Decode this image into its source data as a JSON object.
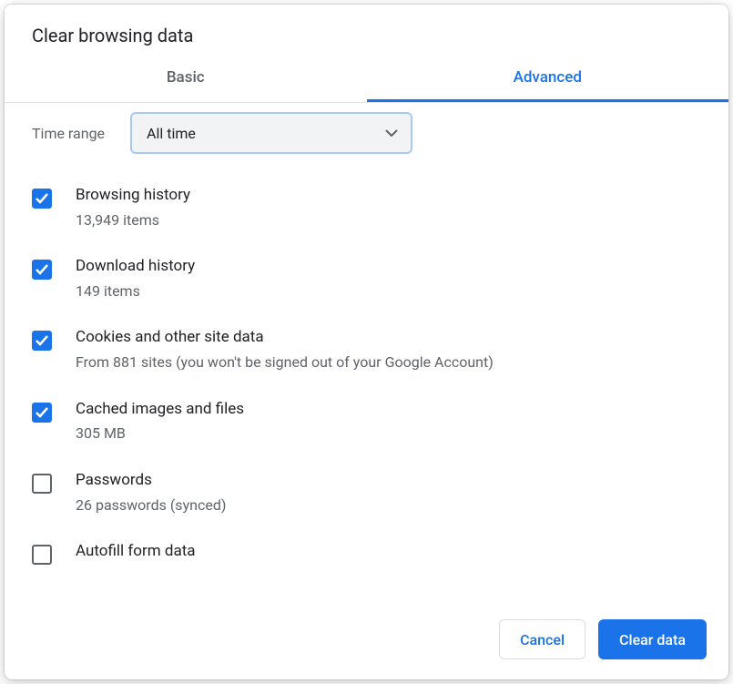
{
  "dialog": {
    "title": "Clear browsing data"
  },
  "tabs": {
    "basic": "Basic",
    "advanced": "Advanced",
    "active": "advanced"
  },
  "time": {
    "label": "Time range",
    "selected": "All time"
  },
  "options": [
    {
      "key": "browsing-history",
      "title": "Browsing history",
      "sub": "13,949 items",
      "checked": true
    },
    {
      "key": "download-history",
      "title": "Download history",
      "sub": "149 items",
      "checked": true
    },
    {
      "key": "cookies",
      "title": "Cookies and other site data",
      "sub": "From 881 sites (you won't be signed out of your Google Account)",
      "checked": true
    },
    {
      "key": "cached",
      "title": "Cached images and files",
      "sub": "305 MB",
      "checked": true
    },
    {
      "key": "passwords",
      "title": "Passwords",
      "sub": "26 passwords (synced)",
      "checked": false
    },
    {
      "key": "autofill",
      "title": "Autofill form data",
      "sub": "",
      "checked": false
    }
  ],
  "footer": {
    "cancel": "Cancel",
    "clear": "Clear data"
  }
}
